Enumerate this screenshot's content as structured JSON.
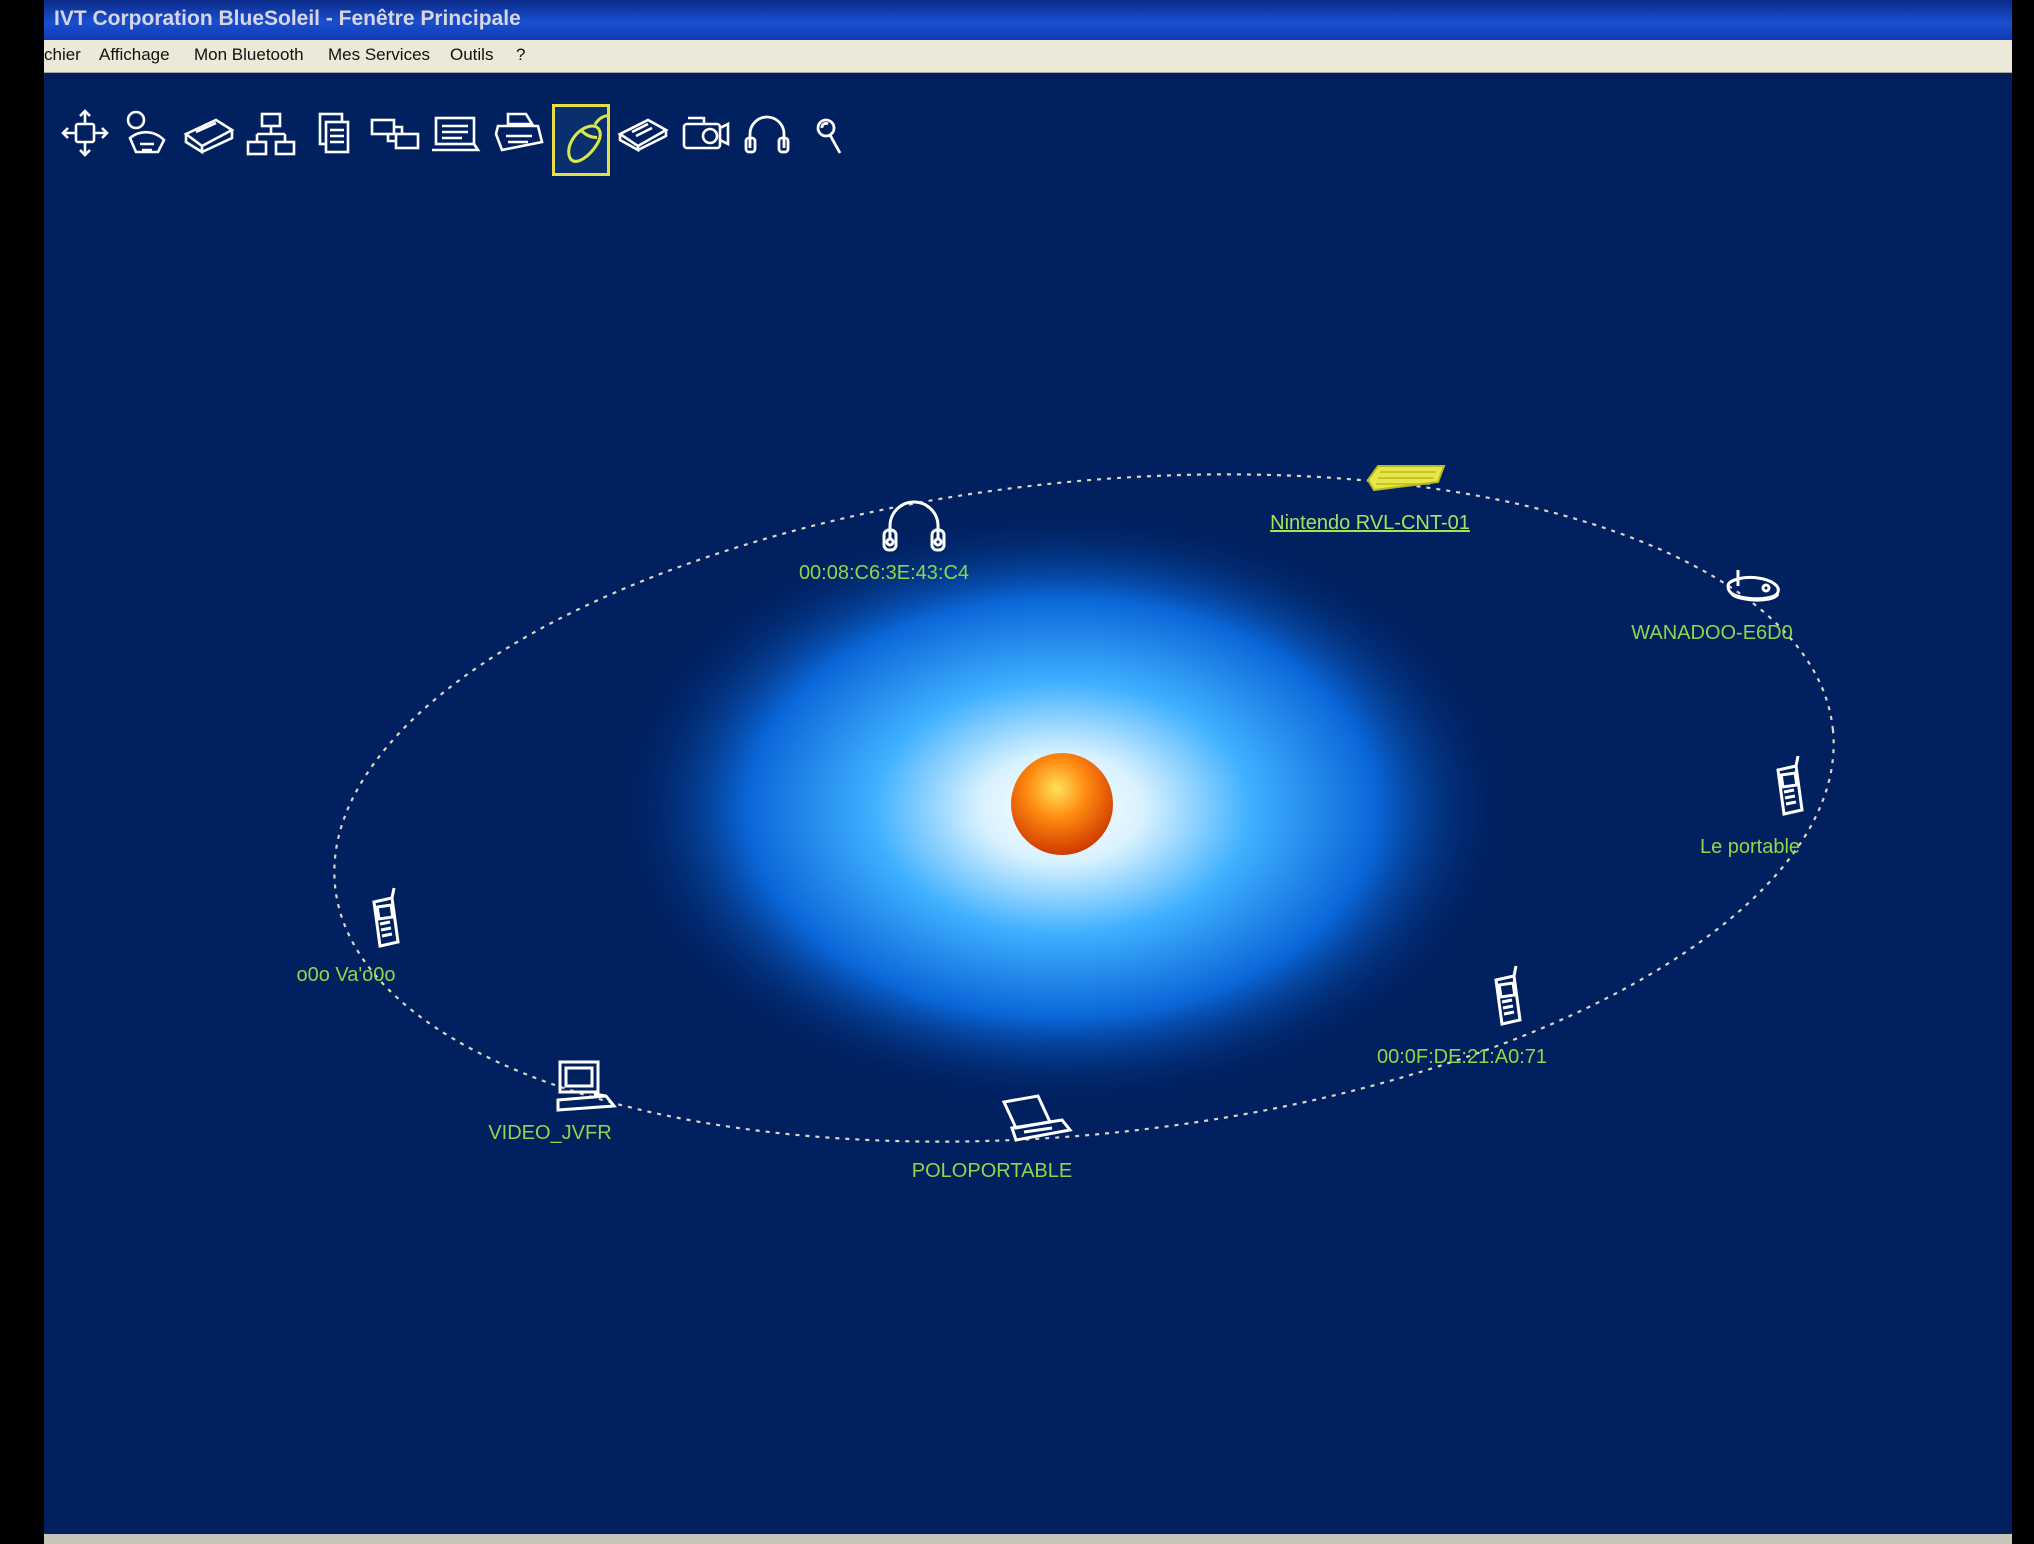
{
  "window": {
    "title": "IVT Corporation BlueSoleil - Fenêtre Principale"
  },
  "menu": {
    "items": [
      "chier",
      "Affichage",
      "Mon Bluetooth",
      "Mes Services",
      "Outils",
      "?"
    ]
  },
  "toolbar": {
    "icons": [
      "network-access-icon",
      "dial-up-networking-icon",
      "fax-icon",
      "lan-access-icon",
      "file-transfer-icon",
      "pim-sync-icon",
      "object-push-icon",
      "printer-icon",
      "hid-mouse-icon",
      "serial-port-icon",
      "camera-icon",
      "headset-icon",
      "audio-gateway-icon"
    ],
    "active_index": 8
  },
  "devices": [
    {
      "label": "00:08:C6:3E:43:C4",
      "icon": "headset-icon"
    },
    {
      "label": "Nintendo RVL-CNT-01",
      "icon": "keyboard-icon",
      "selected": true
    },
    {
      "label": "WANADOO-E6D0",
      "icon": "router-icon"
    },
    {
      "label": "Le portable",
      "icon": "mobile-phone-icon"
    },
    {
      "label": "00:0F:DE:21:A0:71",
      "icon": "mobile-phone-icon"
    },
    {
      "label": "POLOPORTABLE",
      "icon": "laptop-icon"
    },
    {
      "label": "VIDEO_JVFR",
      "icon": "desktop-computer-icon"
    },
    {
      "label": "o0o Va'o0o",
      "icon": "mobile-phone-icon"
    }
  ],
  "colors": {
    "background": "#002060",
    "label": "#8bd84a",
    "selected_device": "#e6e84a",
    "orbit": "#d8d8c0",
    "sun": "#ff6a00",
    "glow": "#1aa0ff"
  }
}
